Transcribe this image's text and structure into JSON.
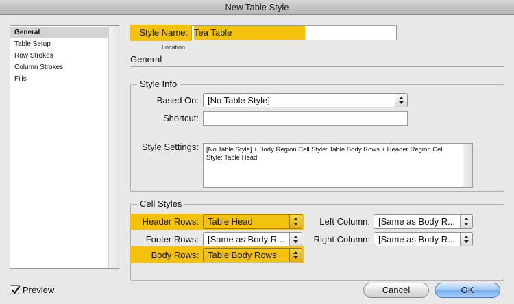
{
  "window": {
    "title": "New Table Style"
  },
  "sidebar": {
    "items": [
      {
        "label": "General",
        "selected": true
      },
      {
        "label": "Table Setup",
        "selected": false
      },
      {
        "label": "Row Strokes",
        "selected": false
      },
      {
        "label": "Column Strokes",
        "selected": false
      },
      {
        "label": "Fills",
        "selected": false
      }
    ]
  },
  "header": {
    "style_name_label": "Style Name:",
    "style_name_value": "Tea Table",
    "location_label": "Location:",
    "section_title": "General"
  },
  "style_info": {
    "group_title": "Style Info",
    "based_on_label": "Based On:",
    "based_on_value": "[No Table Style]",
    "shortcut_label": "Shortcut:",
    "shortcut_value": "",
    "style_settings_label": "Style Settings:",
    "style_settings_text": "[No Table Style] + Body Region Cell Style: Table Body Rows + Header Region Cell Style: Table Head"
  },
  "cell_styles": {
    "group_title": "Cell Styles",
    "header_rows_label": "Header Rows:",
    "header_rows_value": "Table Head",
    "footer_rows_label": "Footer Rows:",
    "footer_rows_value": "[Same as Body R...",
    "body_rows_label": "Body Rows:",
    "body_rows_value": "Table Body Rows",
    "left_column_label": "Left Column:",
    "left_column_value": "[Same as Body R...",
    "right_column_label": "Right Column:",
    "right_column_value": "[Same as Body R..."
  },
  "footer": {
    "preview_label": "Preview",
    "preview_checked": true,
    "cancel_label": "Cancel",
    "ok_label": "OK"
  },
  "colors": {
    "highlight": "#f4c20d",
    "default_button": "#78aeea"
  }
}
